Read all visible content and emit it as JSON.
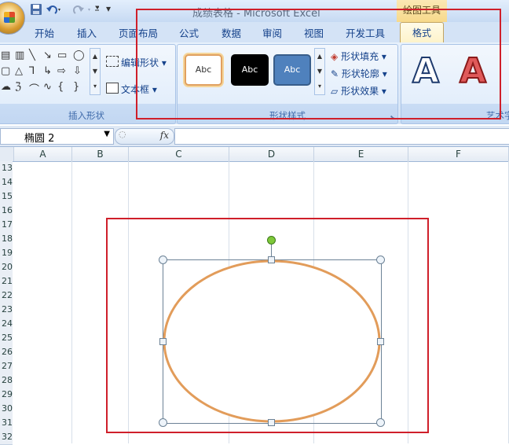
{
  "window": {
    "title": "成绩表格 - Microsoft Excel",
    "context_tools_label": "绘图工具"
  },
  "quick_access": {
    "save_icon": "save-icon",
    "undo_icon": "undo-icon",
    "redo_icon": "redo-icon",
    "customize_icon": "customize-qat-icon"
  },
  "tabs": [
    {
      "label": "开始"
    },
    {
      "label": "插入"
    },
    {
      "label": "页面布局"
    },
    {
      "label": "公式"
    },
    {
      "label": "数据"
    },
    {
      "label": "审阅"
    },
    {
      "label": "视图"
    },
    {
      "label": "开发工具"
    },
    {
      "label": "格式"
    }
  ],
  "ribbon": {
    "insert_shapes": {
      "label": "插入形状",
      "edit_shape": "编辑形状",
      "text_box": "文本框"
    },
    "shape_styles": {
      "label": "形状样式",
      "presets": [
        {
          "text": "Abc",
          "bg": "#ffffff",
          "border": "#e0a060",
          "color": "#333333"
        },
        {
          "text": "Abc",
          "bg": "#000000",
          "border": "#000000",
          "color": "#ffffff"
        },
        {
          "text": "Abc",
          "bg": "#4f81bd",
          "border": "#385d8a",
          "color": "#ffffff"
        }
      ],
      "fill": "形状填充",
      "outline": "形状轮廓",
      "effects": "形状效果"
    },
    "wordart": {
      "label": "艺术字",
      "sample": "A"
    }
  },
  "formula_bar": {
    "name_box": "椭圆 2",
    "fx": "fx",
    "formula": ""
  },
  "sheet": {
    "columns": [
      "A",
      "B",
      "C",
      "D",
      "E",
      "F"
    ],
    "rows": [
      "13",
      "14",
      "15",
      "16",
      "17",
      "18",
      "19",
      "20",
      "21",
      "22",
      "23",
      "24",
      "25",
      "26",
      "27",
      "28",
      "29",
      "30",
      "31",
      "32"
    ]
  },
  "shape": {
    "name": "椭圆 2",
    "outline_color": "#e29c5a"
  },
  "colors": {
    "highlight_box": "#cf1f2a",
    "accent": "#15428b"
  }
}
